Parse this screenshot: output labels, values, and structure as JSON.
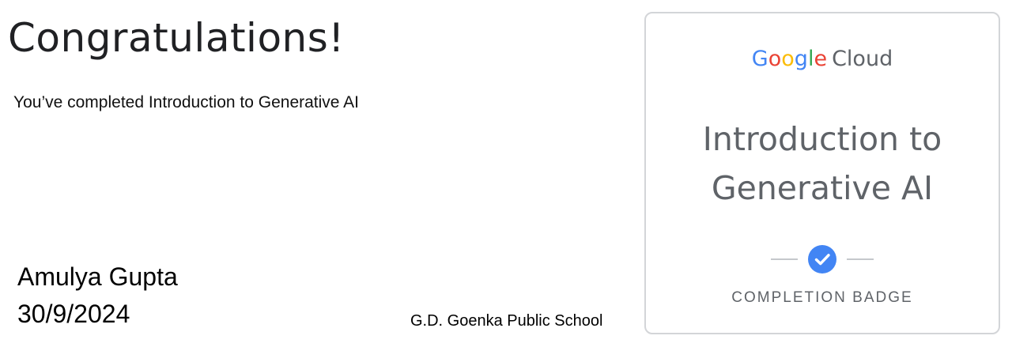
{
  "certificate": {
    "heading": "Congratulations!",
    "completed_line": "You’ve completed Introduction to Generative AI",
    "recipient_name": "Amulya Gupta",
    "date": "30/9/2024",
    "school": "G.D. Goenka Public School"
  },
  "badge": {
    "brand": {
      "google_letters": [
        {
          "char": "G",
          "color": "#4285F4"
        },
        {
          "char": "o",
          "color": "#EA4335"
        },
        {
          "char": "o",
          "color": "#FBBC05"
        },
        {
          "char": "g",
          "color": "#4285F4"
        },
        {
          "char": "l",
          "color": "#34A853"
        },
        {
          "char": "e",
          "color": "#EA4335"
        }
      ],
      "product": "Cloud"
    },
    "title_lines": [
      "Introduction to",
      "Generative AI"
    ],
    "icon": "check-circle-icon",
    "check_color": "#4285F4",
    "caption": "COMPLETION BADGE"
  }
}
